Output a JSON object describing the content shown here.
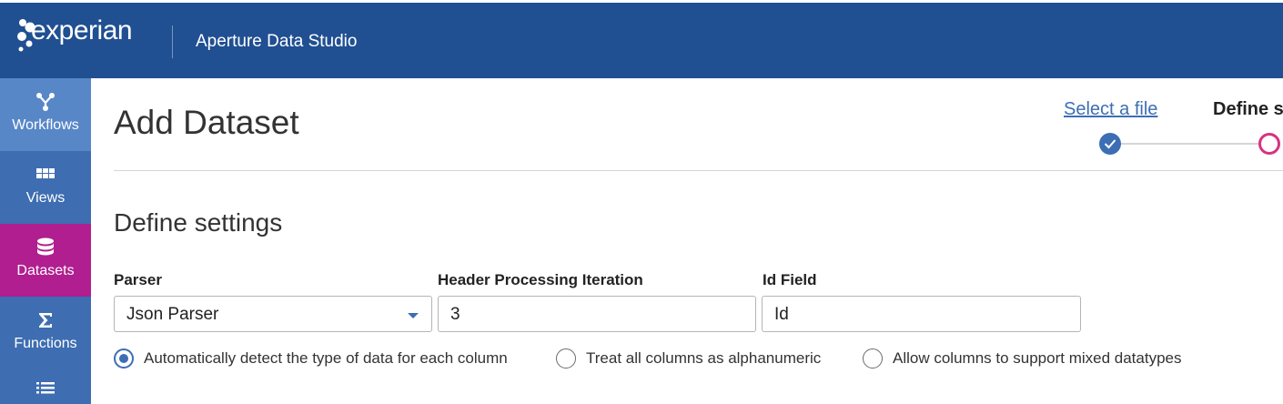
{
  "header": {
    "brand": "experian",
    "brand_tm": "TM",
    "app_title": "Aperture Data Studio",
    "bg_color": "#204f92"
  },
  "sidebar": {
    "items": [
      {
        "label": "Workflows",
        "icon": "workflow-icon"
      },
      {
        "label": "Views",
        "icon": "grid-icon"
      },
      {
        "label": "Datasets",
        "icon": "database-icon",
        "active": true
      },
      {
        "label": "Functions",
        "icon": "sigma-icon"
      },
      {
        "label": "",
        "icon": "list-icon"
      }
    ],
    "active_color": "#b01e8f"
  },
  "main": {
    "title": "Add Dataset",
    "steps": [
      {
        "label": "Select a file",
        "status": "complete"
      },
      {
        "label": "Define se",
        "status": "current"
      }
    ],
    "section_title": "Define settings",
    "fields": {
      "parser": {
        "label": "Parser",
        "value": "Json Parser"
      },
      "header_iteration": {
        "label": "Header Processing Iteration",
        "value": "3"
      },
      "id_field": {
        "label": "Id Field",
        "value": "Id"
      }
    },
    "radio_options": [
      {
        "label": "Automatically detect the type of data for each column",
        "checked": true
      },
      {
        "label": "Treat all columns as alphanumeric",
        "checked": false
      },
      {
        "label": "Allow columns to support mixed datatypes",
        "checked": false
      }
    ]
  },
  "colors": {
    "accent_blue": "#3d6eb3",
    "step_current": "#d8327f"
  }
}
